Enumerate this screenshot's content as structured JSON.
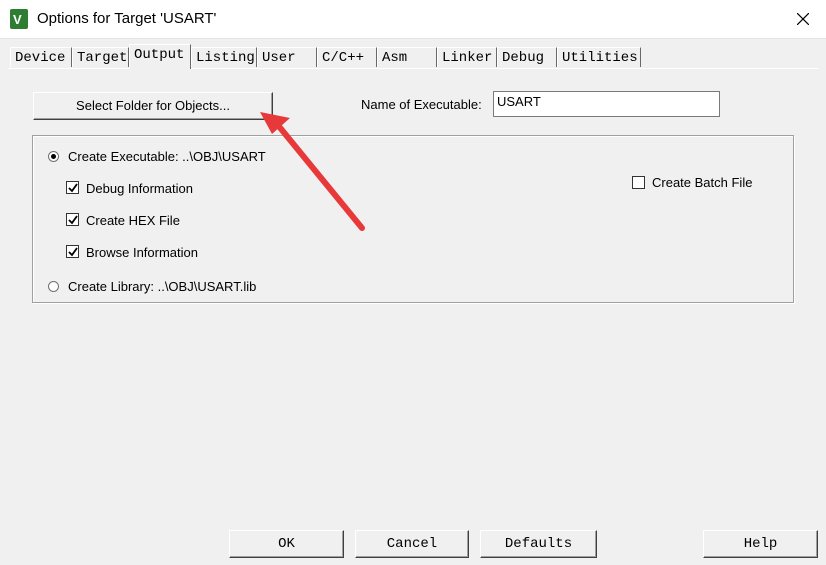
{
  "window": {
    "title": "Options for Target 'USART'"
  },
  "tabs": [
    {
      "label": "Device",
      "active": false
    },
    {
      "label": "Target",
      "active": false
    },
    {
      "label": "Output",
      "active": true
    },
    {
      "label": "Listing",
      "active": false
    },
    {
      "label": "User",
      "active": false
    },
    {
      "label": "C/C++",
      "active": false
    },
    {
      "label": "Asm",
      "active": false
    },
    {
      "label": "Linker",
      "active": false
    },
    {
      "label": "Debug",
      "active": false
    },
    {
      "label": "Utilities",
      "active": false
    }
  ],
  "output": {
    "select_folder_label": "Select Folder for Objects...",
    "name_of_executable_label": "Name of Executable:",
    "name_of_executable_value": "USART",
    "create_executable": {
      "label": "Create Executable:  ..\\OBJ\\USART",
      "selected": true
    },
    "options": [
      {
        "label": "Debug Information",
        "checked": true
      },
      {
        "label": "Create HEX File",
        "checked": true
      },
      {
        "label": "Browse Information",
        "checked": true
      }
    ],
    "create_library": {
      "label": "Create Library:  ..\\OBJ\\USART.lib",
      "selected": false
    },
    "create_batch_file": {
      "label": "Create Batch File",
      "checked": false
    }
  },
  "buttons": {
    "ok": "OK",
    "cancel": "Cancel",
    "defaults": "Defaults",
    "help": "Help"
  },
  "colors": {
    "annotation_arrow": "#e8393a",
    "app_icon": "#2e7d32"
  }
}
